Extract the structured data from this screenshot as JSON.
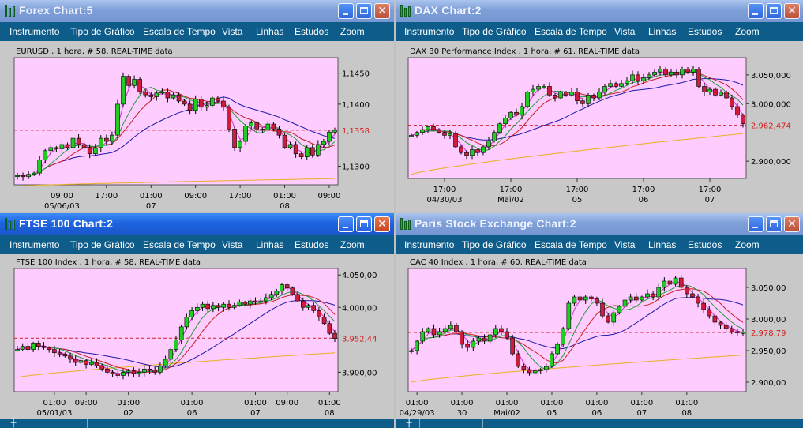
{
  "windows": [
    {
      "id": "forex",
      "title": "Forex Chart:5",
      "active": false,
      "menu": [
        "Instrumento",
        "Tipo de Gráfico",
        "Escala de Tempo",
        "Vista",
        "Linhas",
        "Estudos",
        "Zoom"
      ],
      "chart_data": {
        "type": "candlestick",
        "subtitle": "EURUSD , 1 hora, # 58, REAL-TIME data",
        "ylim": [
          1.127,
          1.1475
        ],
        "y_ticks": [
          {
            "value": 1.145,
            "label": "1,1450"
          },
          {
            "value": 1.14,
            "label": "1,1400"
          },
          {
            "value": 1.13,
            "label": "1,1300"
          }
        ],
        "last_price": {
          "value": 1.1358,
          "label": "1,1358"
        },
        "x_ticks": [
          {
            "index": 8,
            "label": "09:00",
            "sub": "05/06/03"
          },
          {
            "index": 16,
            "label": "17:00",
            "sub": ""
          },
          {
            "index": 24,
            "label": "01:00",
            "sub": "07"
          },
          {
            "index": 32,
            "label": "09:00",
            "sub": ""
          },
          {
            "index": 40,
            "label": "17:00",
            "sub": ""
          },
          {
            "index": 48,
            "label": "01:00",
            "sub": "08"
          },
          {
            "index": 56,
            "label": "09:00",
            "sub": ""
          }
        ],
        "ma_long": {
          "start": 1.1268,
          "end": 1.128
        },
        "closes": [
          1.1285,
          1.1283,
          1.1287,
          1.1289,
          1.131,
          1.1325,
          1.133,
          1.1328,
          1.1335,
          1.133,
          1.1345,
          1.1335,
          1.133,
          1.132,
          1.133,
          1.1345,
          1.134,
          1.135,
          1.14,
          1.1445,
          1.143,
          1.144,
          1.142,
          1.1415,
          1.1412,
          1.1418,
          1.142,
          1.141,
          1.1415,
          1.1405,
          1.14,
          1.139,
          1.1408,
          1.1395,
          1.1398,
          1.141,
          1.1405,
          1.1395,
          1.136,
          1.133,
          1.134,
          1.1365,
          1.137,
          1.136,
          1.1358,
          1.1368,
          1.136,
          1.135,
          1.133,
          1.1335,
          1.132,
          1.1315,
          1.133,
          1.1318,
          1.1335,
          1.134,
          1.1355,
          1.1358
        ]
      }
    },
    {
      "id": "dax",
      "title": "DAX Chart:2",
      "active": false,
      "menu": [
        "Instrumento",
        "Tipo de Gráfico",
        "Escala de Tempo",
        "Vista",
        "Linhas",
        "Estudos",
        "Zoom"
      ],
      "chart_data": {
        "type": "candlestick",
        "subtitle": "DAX 30 Performance Index , 1 hora, # 61, REAL-TIME data",
        "ylim": [
          2870,
          3080
        ],
        "y_ticks": [
          {
            "value": 3050,
            "label": "3.050,000"
          },
          {
            "value": 3000,
            "label": "3.000,000"
          },
          {
            "value": 2900,
            "label": "2.900,000"
          }
        ],
        "last_price": {
          "value": 2962.474,
          "label": "2.962,474"
        },
        "x_ticks": [
          {
            "index": 6,
            "label": "17:00",
            "sub": "04/30/03"
          },
          {
            "index": 18,
            "label": "17:00",
            "sub": "Mai/02"
          },
          {
            "index": 30,
            "label": "17:00",
            "sub": "05"
          },
          {
            "index": 42,
            "label": "17:00",
            "sub": "06"
          },
          {
            "index": 54,
            "label": "17:00",
            "sub": "07"
          }
        ],
        "ma_long": {
          "start": 2877,
          "end": 2948
        },
        "closes": [
          2945,
          2950,
          2955,
          2960,
          2955,
          2950,
          2945,
          2948,
          2925,
          2915,
          2910,
          2920,
          2915,
          2925,
          2935,
          2950,
          2965,
          2975,
          2985,
          2980,
          2995,
          3020,
          3025,
          3030,
          3030,
          3015,
          3010,
          3020,
          3015,
          3020,
          3005,
          3000,
          3015,
          3010,
          3020,
          3030,
          3035,
          3030,
          3035,
          3040,
          3050,
          3040,
          3045,
          3050,
          3055,
          3060,
          3050,
          3055,
          3050,
          3060,
          3055,
          3060,
          3030,
          3020,
          3025,
          3015,
          3020,
          3010,
          2995,
          2980,
          2965
        ]
      }
    },
    {
      "id": "ftse",
      "title": "FTSE 100 Chart:2",
      "active": true,
      "menu": [
        "Instrumento",
        "Tipo de Gráfico",
        "Escala de Tempo",
        "Vista",
        "Linhas",
        "Estudos",
        "Zoom"
      ],
      "chart_data": {
        "type": "candlestick",
        "subtitle": "FTSE 100 Index , 1 hora, # 58, REAL-TIME data",
        "ylim": [
          3870,
          4060
        ],
        "y_ticks": [
          {
            "value": 4050,
            "label": "4.050,00"
          },
          {
            "value": 4000,
            "label": "4.000,00"
          },
          {
            "value": 3900,
            "label": "3.900,00"
          }
        ],
        "last_price": {
          "value": 3952.44,
          "label": "3.952,44"
        },
        "x_ticks": [
          {
            "index": 7,
            "label": "01:00",
            "sub": "05/01/03"
          },
          {
            "index": 13,
            "label": "09:00",
            "sub": ""
          },
          {
            "index": 21,
            "label": "01:00",
            "sub": "02"
          },
          {
            "index": 33,
            "label": "01:00",
            "sub": "06"
          },
          {
            "index": 45,
            "label": "01:00",
            "sub": "07"
          },
          {
            "index": 51,
            "label": "09:00",
            "sub": ""
          },
          {
            "index": 59,
            "label": "01:00",
            "sub": "08"
          }
        ],
        "ma_long": {
          "start": 3892,
          "end": 3930
        },
        "closes": [
          3935,
          3940,
          3935,
          3945,
          3940,
          3938,
          3935,
          3930,
          3928,
          3925,
          3920,
          3915,
          3918,
          3912,
          3915,
          3910,
          3905,
          3900,
          3898,
          3895,
          3900,
          3902,
          3898,
          3900,
          3905,
          3903,
          3900,
          3910,
          3920,
          3935,
          3950,
          3970,
          3985,
          3995,
          4000,
          4005,
          3998,
          4003,
          4000,
          4005,
          4000,
          4003,
          4008,
          4005,
          4010,
          4008,
          4010,
          4015,
          4020,
          4025,
          4035,
          4030,
          4020,
          4010,
          4000,
          4003,
          3995,
          3985,
          3975,
          3960,
          3952
        ]
      }
    },
    {
      "id": "paris",
      "title": "Paris Stock Exchange Chart:2",
      "active": false,
      "menu": [
        "Instrumento",
        "Tipo de Gráfico",
        "Escala de Tempo",
        "Vista",
        "Linhas",
        "Estudos",
        "Zoom"
      ],
      "chart_data": {
        "type": "candlestick",
        "subtitle": "CAC 40 Index , 1 hora, # 60, REAL-TIME data",
        "ylim": [
          2885,
          3080
        ],
        "y_ticks": [
          {
            "value": 3050,
            "label": "3.050,00"
          },
          {
            "value": 3000,
            "label": "3.000,00"
          },
          {
            "value": 2950,
            "label": "2.950,00"
          },
          {
            "value": 2900,
            "label": "2.900,00"
          }
        ],
        "last_price": {
          "value": 2978.79,
          "label": "2.978,79"
        },
        "x_ticks": [
          {
            "index": 1,
            "label": "01:00",
            "sub": "04/29/03"
          },
          {
            "index": 9,
            "label": "01:00",
            "sub": "30"
          },
          {
            "index": 17,
            "label": "01:00",
            "sub": "Mai/02"
          },
          {
            "index": 25,
            "label": "01:00",
            "sub": "05"
          },
          {
            "index": 33,
            "label": "01:00",
            "sub": "06"
          },
          {
            "index": 41,
            "label": "01:00",
            "sub": "07"
          },
          {
            "index": 49,
            "label": "01:00",
            "sub": "08"
          }
        ],
        "ma_long": {
          "start": 2900,
          "end": 2943
        },
        "closes": [
          2950,
          2965,
          2980,
          2985,
          2975,
          2980,
          2985,
          2990,
          2980,
          2960,
          2955,
          2965,
          2970,
          2965,
          2975,
          2985,
          2980,
          2970,
          2945,
          2925,
          2920,
          2915,
          2918,
          2920,
          2925,
          2945,
          2960,
          2985,
          3025,
          3035,
          3030,
          3035,
          3032,
          3025,
          3005,
          2995,
          3010,
          3020,
          3030,
          3035,
          3030,
          3035,
          3040,
          3035,
          3050,
          3060,
          3055,
          3065,
          3050,
          3040,
          3035,
          3025,
          3015,
          3005,
          2995,
          2990,
          2985,
          2980,
          2978,
          2979
        ]
      }
    }
  ]
}
